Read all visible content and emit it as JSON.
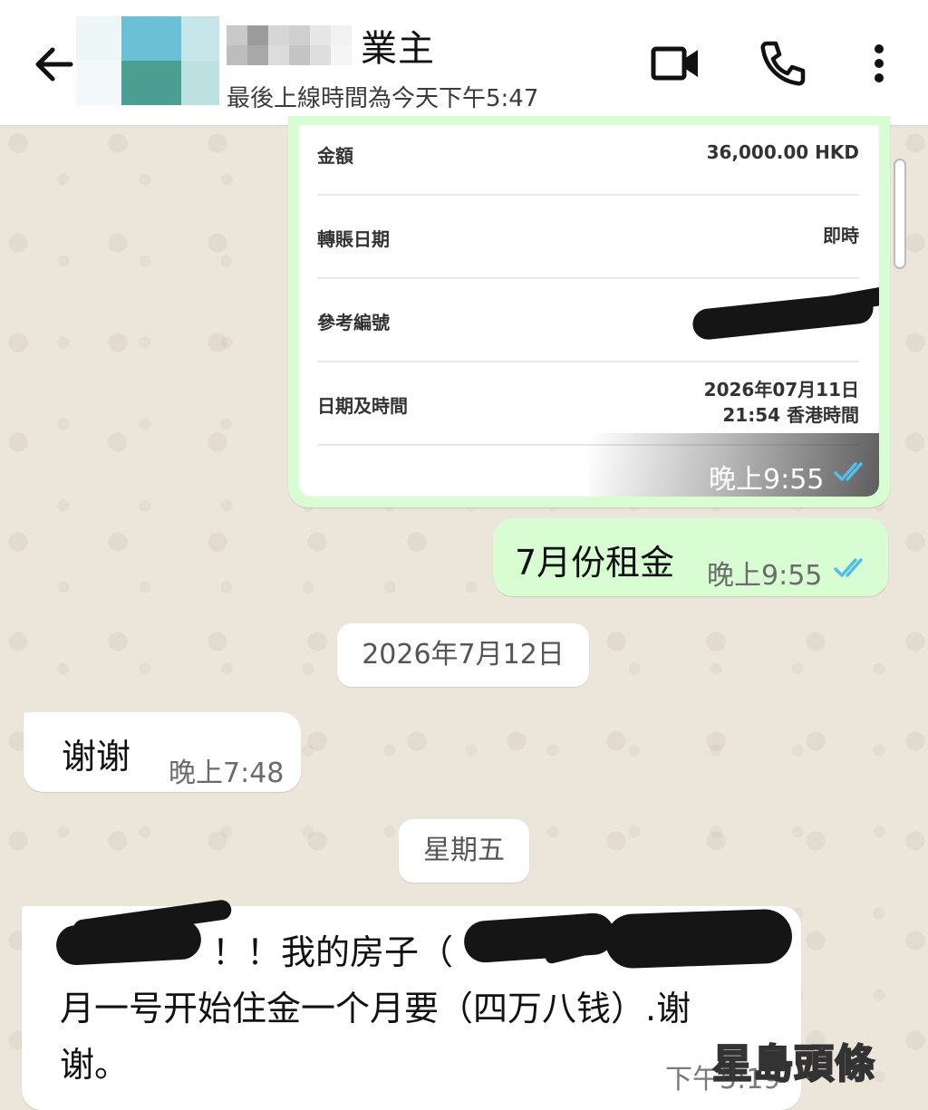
{
  "header": {
    "contact_name": "業主",
    "last_seen": "最後上線時間為今天下午5:47"
  },
  "receipt": {
    "rows": [
      {
        "label": "金額",
        "value": "36,000.00 HKD"
      },
      {
        "label": "轉賬日期",
        "value": "即時"
      },
      {
        "label": "參考編號",
        "value": ""
      },
      {
        "label": "日期及時間",
        "value_line1": "2026年07月11日",
        "value_line2": "21:54 香港時間"
      }
    ],
    "time": "晚上9:55"
  },
  "messages": [
    {
      "text": "7月份租金",
      "time": "晚上9:55"
    },
    {
      "text": "谢谢",
      "time": "晚上7:48"
    },
    {
      "line1": "！！我的房子（",
      "line2": "月一号开始住金一个月要（四万八钱）.谢",
      "line3": "谢。",
      "time": "下午5:19"
    }
  ],
  "date_chips": [
    "2026年7月12日",
    "星期五"
  ],
  "watermark": "星島頭條",
  "colors": {
    "outgoing_bubble": "#d9fdd3",
    "incoming_bubble": "#ffffff",
    "read_ticks": "#53bdeb",
    "wallpaper": "#ebe5da"
  },
  "icons": [
    "back-arrow-icon",
    "video-call-icon",
    "phone-icon",
    "more-vert-icon",
    "double-check-icon"
  ]
}
